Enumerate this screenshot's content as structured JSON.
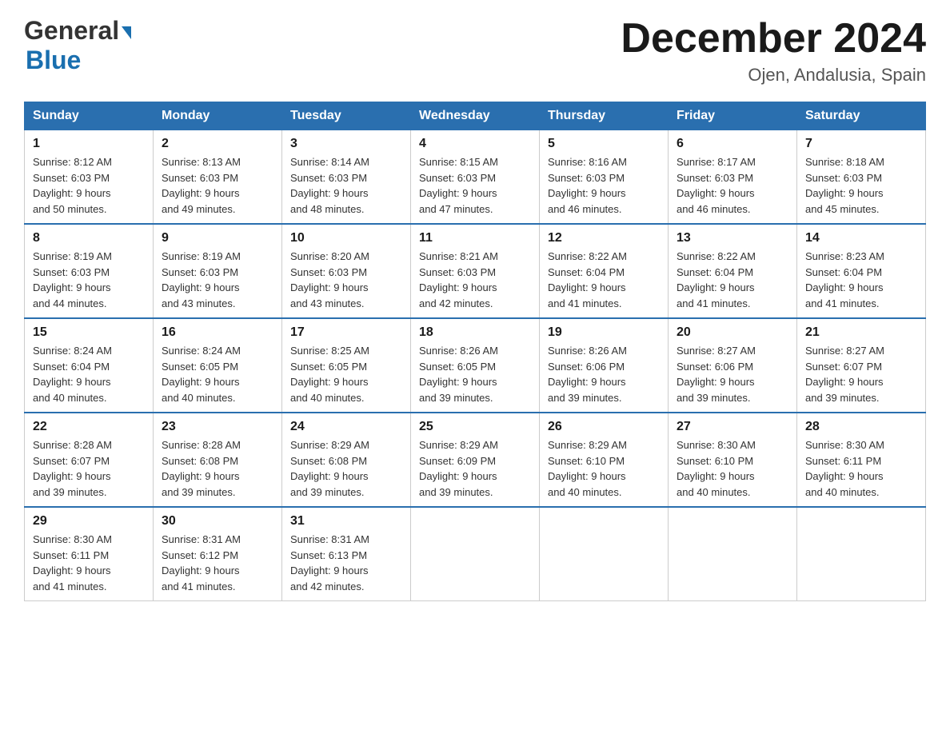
{
  "header": {
    "logo": {
      "general": "General",
      "blue": "Blue",
      "tagline": ""
    },
    "title": "December 2024",
    "location": "Ojen, Andalusia, Spain"
  },
  "days_of_week": [
    "Sunday",
    "Monday",
    "Tuesday",
    "Wednesday",
    "Thursday",
    "Friday",
    "Saturday"
  ],
  "weeks": [
    [
      {
        "num": "1",
        "sunrise": "8:12 AM",
        "sunset": "6:03 PM",
        "daylight": "9 hours and 50 minutes."
      },
      {
        "num": "2",
        "sunrise": "8:13 AM",
        "sunset": "6:03 PM",
        "daylight": "9 hours and 49 minutes."
      },
      {
        "num": "3",
        "sunrise": "8:14 AM",
        "sunset": "6:03 PM",
        "daylight": "9 hours and 48 minutes."
      },
      {
        "num": "4",
        "sunrise": "8:15 AM",
        "sunset": "6:03 PM",
        "daylight": "9 hours and 47 minutes."
      },
      {
        "num": "5",
        "sunrise": "8:16 AM",
        "sunset": "6:03 PM",
        "daylight": "9 hours and 46 minutes."
      },
      {
        "num": "6",
        "sunrise": "8:17 AM",
        "sunset": "6:03 PM",
        "daylight": "9 hours and 46 minutes."
      },
      {
        "num": "7",
        "sunrise": "8:18 AM",
        "sunset": "6:03 PM",
        "daylight": "9 hours and 45 minutes."
      }
    ],
    [
      {
        "num": "8",
        "sunrise": "8:19 AM",
        "sunset": "6:03 PM",
        "daylight": "9 hours and 44 minutes."
      },
      {
        "num": "9",
        "sunrise": "8:19 AM",
        "sunset": "6:03 PM",
        "daylight": "9 hours and 43 minutes."
      },
      {
        "num": "10",
        "sunrise": "8:20 AM",
        "sunset": "6:03 PM",
        "daylight": "9 hours and 43 minutes."
      },
      {
        "num": "11",
        "sunrise": "8:21 AM",
        "sunset": "6:03 PM",
        "daylight": "9 hours and 42 minutes."
      },
      {
        "num": "12",
        "sunrise": "8:22 AM",
        "sunset": "6:04 PM",
        "daylight": "9 hours and 41 minutes."
      },
      {
        "num": "13",
        "sunrise": "8:22 AM",
        "sunset": "6:04 PM",
        "daylight": "9 hours and 41 minutes."
      },
      {
        "num": "14",
        "sunrise": "8:23 AM",
        "sunset": "6:04 PM",
        "daylight": "9 hours and 41 minutes."
      }
    ],
    [
      {
        "num": "15",
        "sunrise": "8:24 AM",
        "sunset": "6:04 PM",
        "daylight": "9 hours and 40 minutes."
      },
      {
        "num": "16",
        "sunrise": "8:24 AM",
        "sunset": "6:05 PM",
        "daylight": "9 hours and 40 minutes."
      },
      {
        "num": "17",
        "sunrise": "8:25 AM",
        "sunset": "6:05 PM",
        "daylight": "9 hours and 40 minutes."
      },
      {
        "num": "18",
        "sunrise": "8:26 AM",
        "sunset": "6:05 PM",
        "daylight": "9 hours and 39 minutes."
      },
      {
        "num": "19",
        "sunrise": "8:26 AM",
        "sunset": "6:06 PM",
        "daylight": "9 hours and 39 minutes."
      },
      {
        "num": "20",
        "sunrise": "8:27 AM",
        "sunset": "6:06 PM",
        "daylight": "9 hours and 39 minutes."
      },
      {
        "num": "21",
        "sunrise": "8:27 AM",
        "sunset": "6:07 PM",
        "daylight": "9 hours and 39 minutes."
      }
    ],
    [
      {
        "num": "22",
        "sunrise": "8:28 AM",
        "sunset": "6:07 PM",
        "daylight": "9 hours and 39 minutes."
      },
      {
        "num": "23",
        "sunrise": "8:28 AM",
        "sunset": "6:08 PM",
        "daylight": "9 hours and 39 minutes."
      },
      {
        "num": "24",
        "sunrise": "8:29 AM",
        "sunset": "6:08 PM",
        "daylight": "9 hours and 39 minutes."
      },
      {
        "num": "25",
        "sunrise": "8:29 AM",
        "sunset": "6:09 PM",
        "daylight": "9 hours and 39 minutes."
      },
      {
        "num": "26",
        "sunrise": "8:29 AM",
        "sunset": "6:10 PM",
        "daylight": "9 hours and 40 minutes."
      },
      {
        "num": "27",
        "sunrise": "8:30 AM",
        "sunset": "6:10 PM",
        "daylight": "9 hours and 40 minutes."
      },
      {
        "num": "28",
        "sunrise": "8:30 AM",
        "sunset": "6:11 PM",
        "daylight": "9 hours and 40 minutes."
      }
    ],
    [
      {
        "num": "29",
        "sunrise": "8:30 AM",
        "sunset": "6:11 PM",
        "daylight": "9 hours and 41 minutes."
      },
      {
        "num": "30",
        "sunrise": "8:31 AM",
        "sunset": "6:12 PM",
        "daylight": "9 hours and 41 minutes."
      },
      {
        "num": "31",
        "sunrise": "8:31 AM",
        "sunset": "6:13 PM",
        "daylight": "9 hours and 42 minutes."
      },
      null,
      null,
      null,
      null
    ]
  ],
  "labels": {
    "sunrise": "Sunrise:",
    "sunset": "Sunset:",
    "daylight": "Daylight:"
  }
}
